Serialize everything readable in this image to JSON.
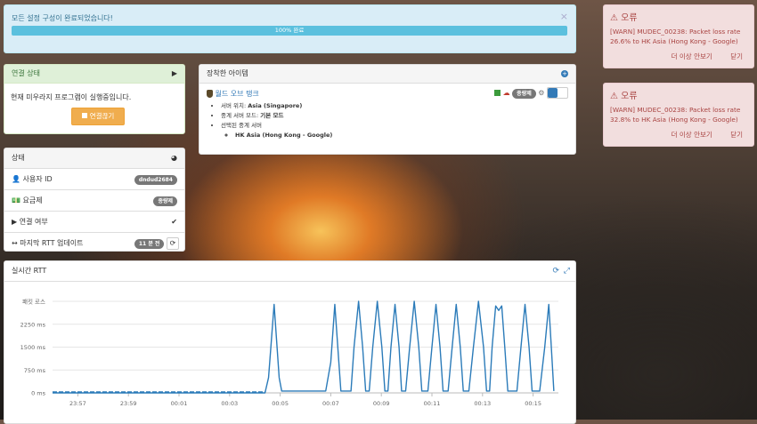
{
  "progress_alert": {
    "message": "모든 설정 구성이 완료되었습니다!",
    "progress_label": "100% 완료",
    "progress": 1.0
  },
  "connection": {
    "title": "연결 상태",
    "message": "현재 미우라지 프로그램이 실행중입니다.",
    "button": "연결끊기"
  },
  "status": {
    "title": "상태",
    "rows": [
      {
        "label": "사용자 ID",
        "value": "dndud2684"
      },
      {
        "label": "요금제",
        "value": "종량제"
      },
      {
        "label": "연결 여부",
        "value": "✔"
      },
      {
        "label": "마지막 RTT 업데이트",
        "value": "11 분 전"
      }
    ]
  },
  "equipped": {
    "title": "장착한 아이템",
    "item_name": "월드 오브 탱크",
    "plan_badge": "종량제",
    "details": {
      "server_location_label": "서버 위치:",
      "server_location_value": "Asia (Singapore)",
      "relay_mode_label": "중계 서버 모드:",
      "relay_mode_value": "기본 모드",
      "selected_relay_label": "선택된 중계 서버",
      "selected_relay_value": "HK Asia (Hong Kong - Google)"
    }
  },
  "errors": [
    {
      "title": "오류",
      "message": "[WARN] MUDEC_00238: Packet loss rate 26.6% to HK Asia (Hong Kong - Google)",
      "more": "더 이상 안보기",
      "close": "닫기"
    },
    {
      "title": "오류",
      "message": "[WARN] MUDEC_00238: Packet loss rate 32.8% to HK Asia (Hong Kong - Google)",
      "more": "더 이상 안보기",
      "close": "닫기"
    }
  ],
  "rtt_panel": {
    "title": "실시간 RTT"
  },
  "chart_data": {
    "type": "line",
    "ylabels": [
      "패킷 로스",
      "2250 ms",
      "1500 ms",
      "750 ms",
      "0 ms"
    ],
    "yticks": [
      3000,
      2250,
      1500,
      750,
      0
    ],
    "ylim": [
      0,
      3000
    ],
    "xlabels": [
      "23:57",
      "23:59",
      "00:01",
      "00:03",
      "00:05",
      "00:07",
      "00:09",
      "00:11",
      "00:13",
      "00:15"
    ],
    "xlim": [
      0,
      100
    ],
    "xtick_positions": [
      5,
      15,
      25,
      35,
      45,
      55,
      65,
      75,
      85,
      95
    ],
    "series_color": "#2b7bb9",
    "points": [
      [
        0,
        0
      ],
      [
        42,
        0
      ],
      [
        42.7,
        500
      ],
      [
        43.8,
        2900
      ],
      [
        44.8,
        500
      ],
      [
        45.3,
        60
      ],
      [
        52,
        60
      ],
      [
        54,
        60
      ],
      [
        55,
        1000
      ],
      [
        55.8,
        2900
      ],
      [
        56.6,
        1000
      ],
      [
        57,
        60
      ],
      [
        59,
        60
      ],
      [
        59.6,
        1500
      ],
      [
        60.5,
        3000
      ],
      [
        61.3,
        1500
      ],
      [
        61.9,
        60
      ],
      [
        62.6,
        60
      ],
      [
        63.3,
        1500
      ],
      [
        64.2,
        3000
      ],
      [
        65.1,
        1500
      ],
      [
        65.7,
        60
      ],
      [
        66.3,
        60
      ],
      [
        66.9,
        1500
      ],
      [
        67.7,
        2900
      ],
      [
        68.5,
        1500
      ],
      [
        69,
        60
      ],
      [
        69.8,
        60
      ],
      [
        70.6,
        1500
      ],
      [
        71.5,
        3000
      ],
      [
        72.4,
        1500
      ],
      [
        73,
        60
      ],
      [
        74.2,
        60
      ],
      [
        75,
        1500
      ],
      [
        75.8,
        2900
      ],
      [
        76.6,
        1500
      ],
      [
        77.2,
        60
      ],
      [
        78.2,
        60
      ],
      [
        79,
        1500
      ],
      [
        79.8,
        2900
      ],
      [
        80.6,
        1500
      ],
      [
        81.2,
        60
      ],
      [
        82.3,
        60
      ],
      [
        83.2,
        1500
      ],
      [
        84.2,
        3000
      ],
      [
        85.2,
        1500
      ],
      [
        85.8,
        60
      ],
      [
        86.4,
        60
      ],
      [
        86.9,
        1500
      ],
      [
        87.6,
        2850
      ],
      [
        88.2,
        2700
      ],
      [
        88.8,
        2850
      ],
      [
        89.4,
        1500
      ],
      [
        90,
        60
      ],
      [
        91.8,
        60
      ],
      [
        92.6,
        1500
      ],
      [
        93.4,
        2900
      ],
      [
        94.2,
        1500
      ],
      [
        94.8,
        60
      ],
      [
        96.3,
        60
      ],
      [
        97.3,
        1500
      ],
      [
        98.1,
        2900
      ],
      [
        98.6,
        1500
      ],
      [
        99.1,
        60
      ]
    ]
  }
}
